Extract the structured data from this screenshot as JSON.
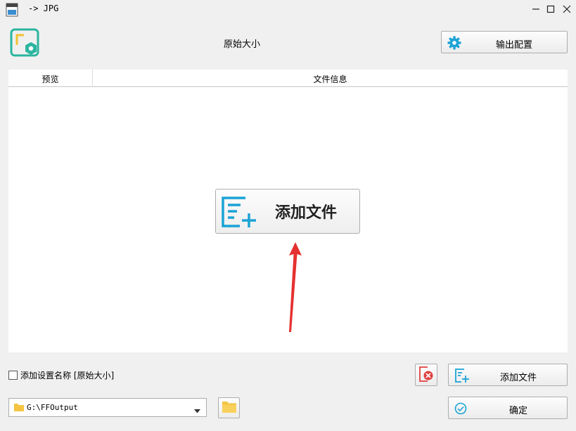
{
  "window": {
    "title": "-> JPG",
    "icons": {
      "app": "jpg-file-icon",
      "minimize": "minimize-icon",
      "maximize": "maximize-icon",
      "close": "close-icon"
    }
  },
  "header": {
    "logo_icon": "image-convert-logo-icon",
    "title": "原始大小",
    "config_button": {
      "label": "输出配置",
      "icon": "gear-icon"
    }
  },
  "table": {
    "columns": [
      "预览",
      "文件信息"
    ],
    "rows": []
  },
  "center_add_button": {
    "label": "添加文件",
    "icon": "add-file-icon"
  },
  "footer": {
    "checkbox": {
      "label": "添加设置名称 [原始大小]",
      "checked": false
    },
    "clear_button": {
      "icon": "clear-list-icon"
    },
    "add_button": {
      "label": "添加文件",
      "icon": "add-file-icon"
    },
    "output_path": {
      "value": "G:\\FFOutput",
      "icon": "folder-icon"
    },
    "folder_button": {
      "icon": "open-folder-icon"
    },
    "ok_button": {
      "label": "确定",
      "icon": "check-circle-icon"
    }
  },
  "colors": {
    "accent": "#1ba3d6",
    "logo_teal": "#2bb5a0",
    "logo_yellow": "#f2c230",
    "clear_red": "#e0413f",
    "arrow_red": "#e53030"
  }
}
